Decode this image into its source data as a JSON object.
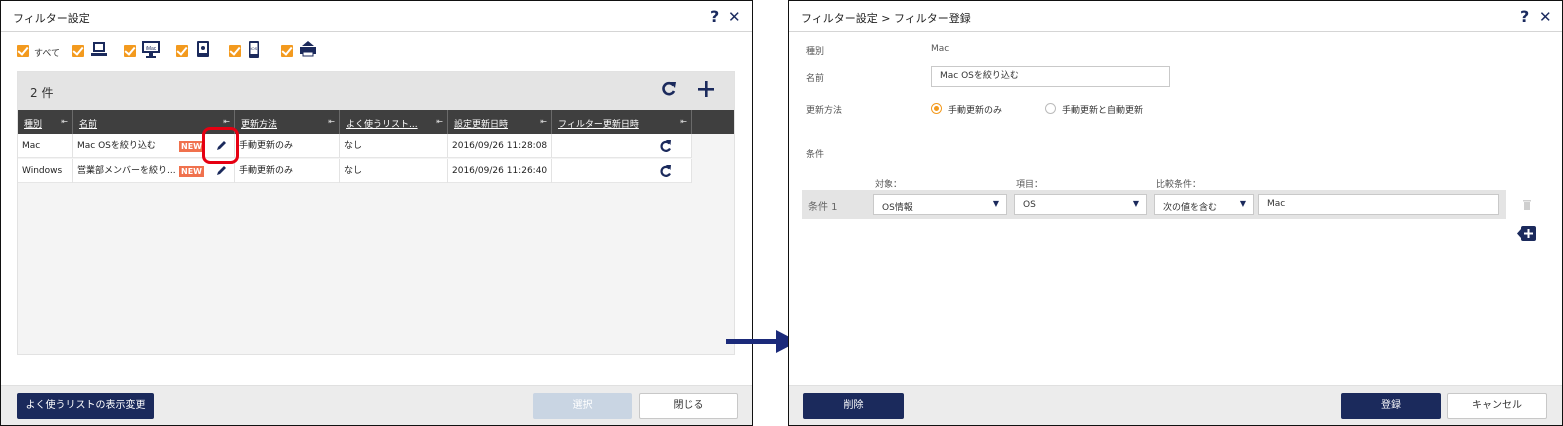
{
  "left_dialog": {
    "title": "フィルター設定",
    "help_icon": "?",
    "close_icon": "✕",
    "filters": {
      "all_label": "すべて",
      "device_icons": [
        "laptop-mac-icon",
        "desktop-mac-icon",
        "ipad-icon",
        "iphone-icon",
        "mobile-phone-icon",
        "printer-icon"
      ],
      "device_icon_texts": [
        "",
        "iMac",
        "",
        "iOS",
        "",
        ""
      ]
    },
    "list": {
      "count": "2 件",
      "columns": [
        "種別",
        "名前",
        "更新方法",
        "よく使うリスト...",
        "設定更新日時",
        "フィルター更新日時"
      ],
      "rows": [
        {
          "type": "Mac",
          "name": "Mac OSを絞り込む",
          "badge": "NEW",
          "update": "手動更新のみ",
          "fav": "なし",
          "updated": "2016/09/26 11:28:08"
        },
        {
          "type": "Windows",
          "name": "営業部メンバーを絞り...",
          "badge": "NEW",
          "update": "手動更新のみ",
          "fav": "なし",
          "updated": "2016/09/26 11:26:40"
        }
      ]
    },
    "footer": {
      "favorites_button": "よく使うリストの表示変更",
      "select_button": "選択",
      "close_button": "閉じる"
    }
  },
  "right_dialog": {
    "title": "フィルター設定 > フィルター登録",
    "help_icon": "?",
    "close_icon": "✕",
    "type_label": "種別",
    "type_value": "Mac",
    "name_label": "名前",
    "name_value": "Mac OSを絞り込む",
    "update_label": "更新方法",
    "update_options": [
      "手動更新のみ",
      "手動更新と自動更新"
    ],
    "update_selected": "手動更新のみ",
    "conditions_label": "条件",
    "cond_headers": [
      "対象：",
      "項目：",
      "比較条件："
    ],
    "condition": {
      "label": "条件 1",
      "target": "OS情報",
      "item": "OS",
      "compare": "次の値を含む",
      "value": "Mac"
    },
    "footer": {
      "delete_button": "削除",
      "register_button": "登録",
      "cancel_button": "キャンセル"
    }
  },
  "colors": {
    "navy": "#1b2a5c",
    "orange": "#f39a1e",
    "new_badge": "#f0714d",
    "highlight_red": "#e60012"
  }
}
